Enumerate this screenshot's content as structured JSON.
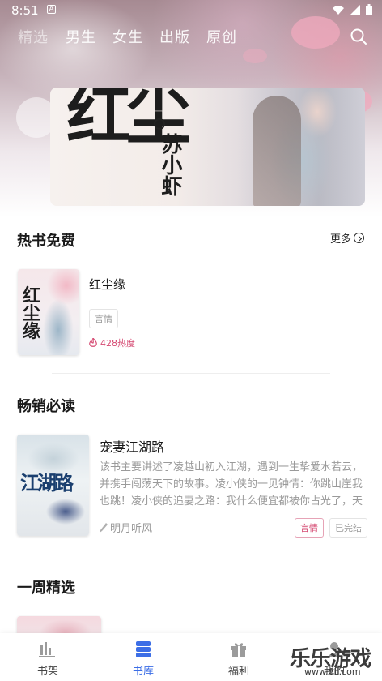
{
  "status_bar": {
    "time": "8:51",
    "notification_glyph": "A"
  },
  "top_nav": {
    "tabs": [
      {
        "label": "精选"
      },
      {
        "label": "男生"
      },
      {
        "label": "女生"
      },
      {
        "label": "出版"
      },
      {
        "label": "原创"
      }
    ],
    "active_index": 0
  },
  "banner": {
    "calligraphy": "红尘",
    "author": "苏小虾"
  },
  "hot_free": {
    "title": "热书免费",
    "more_label": "更多",
    "book": {
      "cover_calligraphy": "红尘缘",
      "title": "红尘缘",
      "tag": "言情",
      "heat": "428热度"
    }
  },
  "bestsellers": {
    "title": "畅销必读",
    "book": {
      "cover_calligraphy": "江湖路",
      "title": "宠妻江湖路",
      "description": "该书主要讲述了凌越山初入江湖，遇到一生挚爱水若云，并携手闯荡天下的故事。凌小侠的一见钟情：你跳山崖我也跳！凌小侠的追妻之路：我什么便宜都被你占光了，天天…",
      "author": "明月听风",
      "tags": [
        "言情",
        "已完结"
      ]
    }
  },
  "weekly": {
    "title": "一周精选"
  },
  "bottom_nav": {
    "items": [
      {
        "label": "书架",
        "icon": "bookshelf-icon"
      },
      {
        "label": "书库",
        "icon": "library-icon"
      },
      {
        "label": "福利",
        "icon": "gift-icon"
      },
      {
        "label": "我的",
        "icon": "profile-icon"
      }
    ],
    "active_index": 1
  },
  "watermark": {
    "text": "乐乐游戏",
    "url": "www.6ll.com"
  },
  "colors": {
    "accent": "#3c6ee6",
    "pink": "#d54a72",
    "muted": "#9a9a9a"
  }
}
